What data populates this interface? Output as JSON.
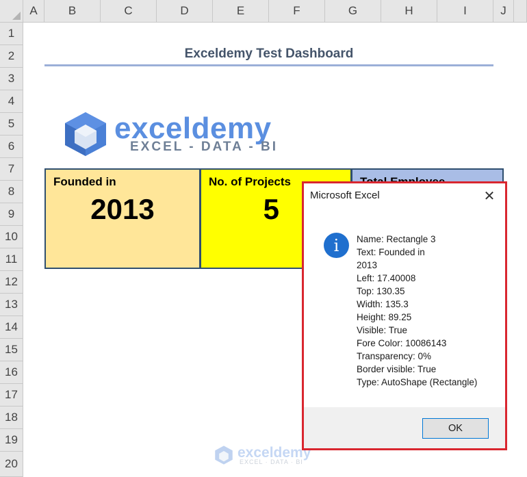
{
  "columns": [
    "A",
    "B",
    "C",
    "D",
    "E",
    "F",
    "G",
    "H",
    "I",
    "J"
  ],
  "rows": [
    "1",
    "2",
    "3",
    "4",
    "5",
    "6",
    "7",
    "8",
    "9",
    "10",
    "11",
    "12",
    "13",
    "14",
    "15",
    "16",
    "17",
    "18",
    "19",
    "20"
  ],
  "dashboard": {
    "title": "Exceldemy Test Dashboard",
    "logo_word": "exceldemy",
    "logo_sub": "EXCEL - DATA - BI"
  },
  "cards": [
    {
      "label": "Founded in",
      "value": "2013",
      "color": "#ffe699"
    },
    {
      "label": "No. of Projects",
      "value": "5",
      "color": "#ffff00"
    },
    {
      "label": "Total Employee",
      "value": "",
      "color": "#a9bde6"
    }
  ],
  "dialog": {
    "title": "Microsoft Excel",
    "close": "✕",
    "icon": "info-icon",
    "lines": [
      "Name: Rectangle 3",
      "Text: Founded in",
      "2013",
      "Left: 17.40008",
      "Top: 130.35",
      "Width: 135.3",
      "Height: 89.25",
      "Visible: True",
      "Fore Color: 10086143",
      "Transparency: 0%",
      "Border visible: True",
      "Type: AutoShape (Rectangle)"
    ],
    "ok_label": "OK"
  },
  "watermark": {
    "word": "exceldemy",
    "sub": "EXCEL · DATA · BI"
  }
}
